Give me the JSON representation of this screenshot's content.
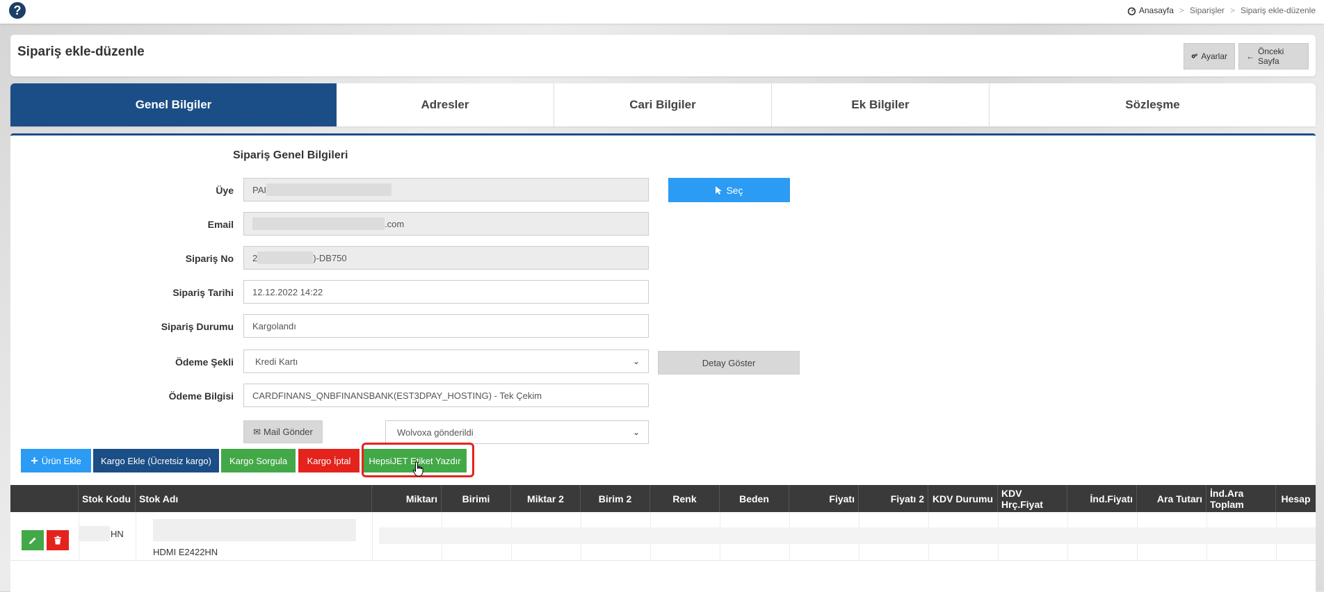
{
  "topbar": {
    "help_icon": "question-circle-icon",
    "breadcrumb": [
      "Anasayfa",
      "Siparişler",
      "Sipariş ekle-düzenle"
    ],
    "breadcrumb_sep": ">"
  },
  "header": {
    "title": "Sipariş ekle-düzenle",
    "settings_label": "Ayarlar",
    "back_label": "Önceki Sayfa"
  },
  "tabs": [
    {
      "label": "Genel Bilgiler",
      "active": true
    },
    {
      "label": "Adresler"
    },
    {
      "label": "Cari Bilgiler"
    },
    {
      "label": "Ek Bilgiler"
    },
    {
      "label": "Sözleşme"
    }
  ],
  "form": {
    "section_title": "Sipariş Genel Bilgileri",
    "uye": {
      "label": "Üye",
      "value": "PAI"
    },
    "email": {
      "label": "Email",
      "value": ".com"
    },
    "siparis_no": {
      "label": "Sipariş No",
      "prefix": "2",
      "value": ")-DB750"
    },
    "siparis_tarihi": {
      "label": "Sipariş Tarihi",
      "value": "12.12.2022 14:22"
    },
    "siparis_durumu": {
      "label": "Sipariş Durumu",
      "value": "Kargolandı"
    },
    "odeme_sekli": {
      "label": "Ödeme Şekli",
      "value": "Kredi Kartı"
    },
    "odeme_bilgisi": {
      "label": "Ödeme Bilgisi",
      "value": "CARDFINANS_QNBFINANSBANK(EST3DPAY_HOSTING) - Tek Çekim"
    },
    "sec_label": "Seç",
    "detay_label": "Detay Göster",
    "mail_label": "Mail Gönder",
    "status_select": "Wolvoxa gönderildi"
  },
  "actions": {
    "add_product": "Ürün Ekle",
    "kargo_ekle": "Kargo Ekle (Ücretsiz kargo)",
    "kargo_sorgula": "Kargo Sorgula",
    "kargo_iptal": "Kargo İptal",
    "hepsijet": "HepsiJET Etiket Yazdır"
  },
  "table": {
    "columns": [
      "Stok Kodu",
      "Stok Adı",
      "Miktarı",
      "Birimi",
      "Miktar 2",
      "Birim 2",
      "Renk",
      "Beden",
      "Fiyatı",
      "Fiyatı 2",
      "KDV Durumu",
      "KDV Hrç.Fiyat",
      "İnd.Fiyatı",
      "Ara Tutarı",
      "İnd.Ara Toplam",
      "Hesap"
    ],
    "rows": [
      {
        "stok_kodu": "HN",
        "stok_adi": "HDMI E2422HN"
      }
    ]
  },
  "colors": {
    "primary": "#1b4e86",
    "info": "#2b9bf4",
    "success": "#43a847",
    "danger": "#e4231c",
    "table_header": "#3a3a3a"
  }
}
